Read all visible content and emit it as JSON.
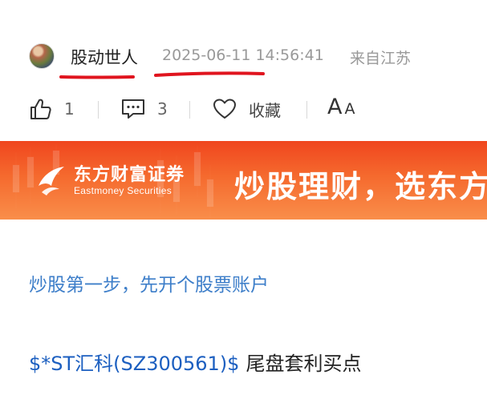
{
  "author": {
    "name": "股动世人",
    "time": "2025-06-11 14:56:41",
    "source": "来自江苏"
  },
  "actions": {
    "like_count": "1",
    "comment_count": "3",
    "favorite_label": "收藏",
    "font_big": "A",
    "font_small": "A"
  },
  "banner": {
    "brand_cn": "东方财富证券",
    "brand_en": "Eastmoney Securities",
    "slogan": "炒股理财，选东方"
  },
  "content": {
    "promo_link": "炒股第一步，先开个股票账户",
    "stock_tag": "$*ST汇科(SZ300561)$",
    "post_title": "尾盘套利买点"
  },
  "colors": {
    "link_blue": "#3d7ec9",
    "stock_blue": "#1c5fc0",
    "annotation_red": "#e0141e",
    "banner_orange": "#f0461e"
  },
  "icons": [
    "thumbs-up-icon",
    "comment-icon",
    "heart-icon",
    "eastmoney-logo-icon"
  ]
}
